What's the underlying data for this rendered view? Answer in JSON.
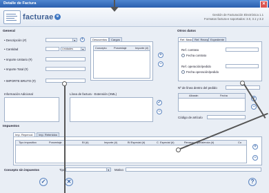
{
  "window": {
    "title": "Detalle de Factura",
    "close_glyph": "✕"
  },
  "header": {
    "logo_text": "facturae",
    "logo_badge": "e",
    "line1": "Gestión de Facturación Electrónica 1.1",
    "line2": "Formatos factura-e soportados: 3.0, 3.1 y 3.2"
  },
  "general": {
    "section": "General",
    "descripcion_label": "• Descripción (#)",
    "cantidad_label": "• Cantidad",
    "cantidad_unit": "Unidades",
    "importe_unitario_label": "• Importe Unitario (#)",
    "importe_total_label": "• Importe Total (#)",
    "importe_bruto_label": "• IMPORTE BRUTO (#)"
  },
  "descuentos": {
    "tabs": [
      "Descuentos",
      "Cargos"
    ],
    "columns": [
      "Concepto",
      "Porcentaje",
      "Importe (#)"
    ]
  },
  "otros_datos": {
    "section": "Otros datos",
    "tabs": [
      "Ref. Básico",
      "Ref. Receptor",
      "Expediente"
    ],
    "ref_contrato_label": "Ref. contrato",
    "fecha_contrato_label": "Fecha contrato",
    "ref_operacion_label": "Ref. operación/pedido",
    "fecha_operacion_label": "Fecha operación/pedido",
    "num_linea_label": "Nº de línea dentro del pedido",
    "periodo_columns": [
      "Albarán",
      "Fecha"
    ],
    "codigo_articulo_label": "Código de artículo"
  },
  "informacion": {
    "adicional_label": "Información Adicional",
    "extension_label": "Línea de factura - Extensión (XML)"
  },
  "impuestos": {
    "section": "Impuestos",
    "tabs": [
      "Imp. Repercut.",
      "Imp. Retenidos"
    ],
    "columns": [
      "Tipo impositivo",
      "Porcentaje",
      "BI (#)",
      "Importe (#)",
      "BI Especial (#)",
      "C. Especial (#)",
      "Recargo equivalencia (#)",
      "Co"
    ]
  },
  "concepto": {
    "label": "Concepto sin impuestos",
    "tipo_label": "Tipo",
    "motivo_label": "Motivo"
  },
  "buttons": {
    "add_glyph": "+",
    "remove_glyph": "−",
    "help_glyph": "?",
    "cancel_glyph": "✕"
  },
  "colors": {
    "accent": "#3f78c4",
    "title_bar": "#2a5fae",
    "background": "#e9eef5"
  }
}
